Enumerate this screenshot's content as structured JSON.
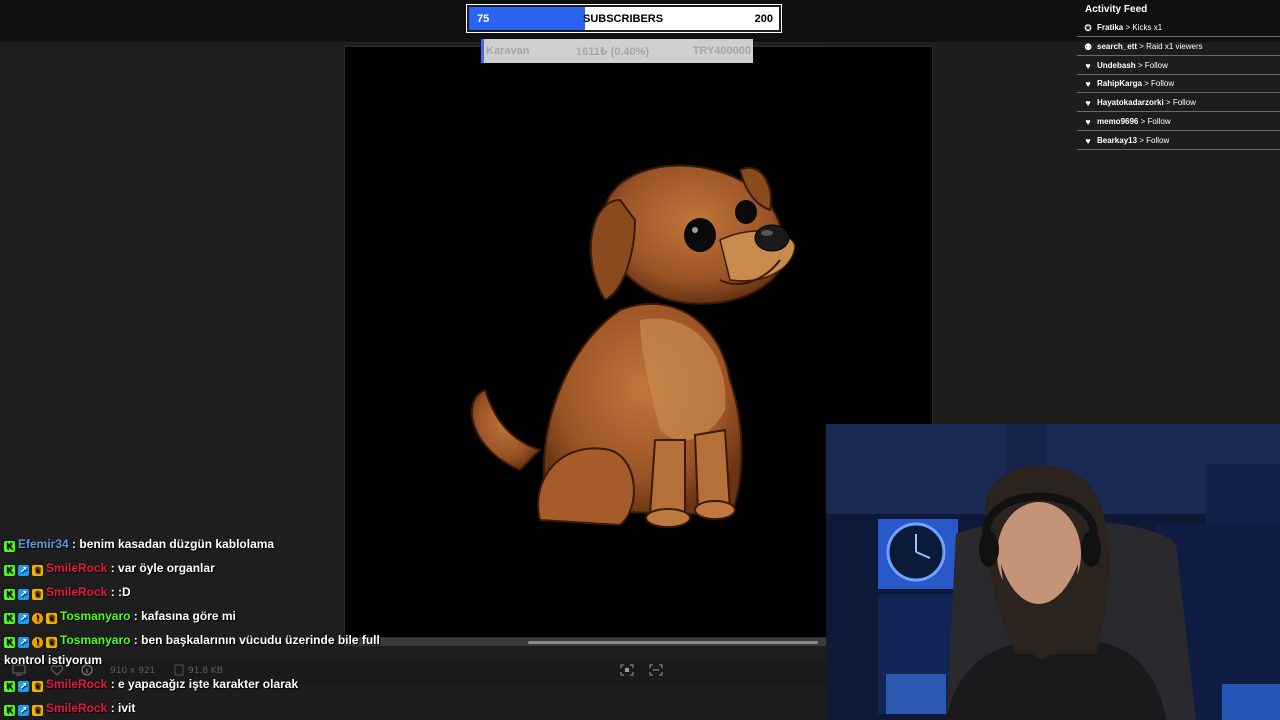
{
  "subscriber_goal": {
    "current": "75",
    "label": "SUBSCRIBERS",
    "target": "200",
    "progress_fraction": 0.375,
    "fill_color": "#2a63f0"
  },
  "donation_goal": {
    "name": "Karavan",
    "amount": "1611₺ (0.40%)",
    "target": "TRY400000"
  },
  "activity_feed": {
    "title": "Activity Feed",
    "items": [
      {
        "user": "Fratika",
        "action": " > Kicks x1",
        "icon": "kick-icon"
      },
      {
        "user": "search_ett",
        "action": " > Raid x1 viewers",
        "icon": "raid-icon"
      },
      {
        "user": "Undebash",
        "action": " > Follow",
        "icon": "heart-icon"
      },
      {
        "user": "RahipKarga",
        "action": " > Follow",
        "icon": "heart-icon"
      },
      {
        "user": "Hayatokadarzorki",
        "action": " > Follow",
        "icon": "heart-icon"
      },
      {
        "user": "memo9696",
        "action": " > Follow",
        "icon": "heart-icon"
      },
      {
        "user": "Bearkay13",
        "action": " > Follow",
        "icon": "heart-icon"
      }
    ]
  },
  "image_viewer": {
    "dimensions": "910 x 921",
    "file_size": "91.8 KB"
  },
  "chat": {
    "messages": [
      {
        "user": "Efemir34",
        "text": " : benim kasadan düzgün kablolama",
        "color": "#5b9bd5"
      },
      {
        "user": "SmileRock",
        "text": " : var öyle organlar",
        "color": "#e01b3c"
      },
      {
        "user": "SmileRock",
        "text": " : :D",
        "color": "#e01b3c"
      },
      {
        "user": "Tosmanyaro",
        "text": " : kafasına göre mi",
        "color": "#53fc18"
      },
      {
        "user": "Tosmanyaro",
        "text": " : ben başkalarının vücudu üzerinde bile full",
        "color": "#53fc18"
      },
      {
        "user": "",
        "text": "kontrol istiyorum",
        "color": "#ffffff"
      },
      {
        "user": "SmileRock",
        "text": " : e yapacağız işte karakter olarak",
        "color": "#e01b3c"
      },
      {
        "user": "SmileRock",
        "text": " : ivit",
        "color": "#e01b3c"
      }
    ]
  }
}
